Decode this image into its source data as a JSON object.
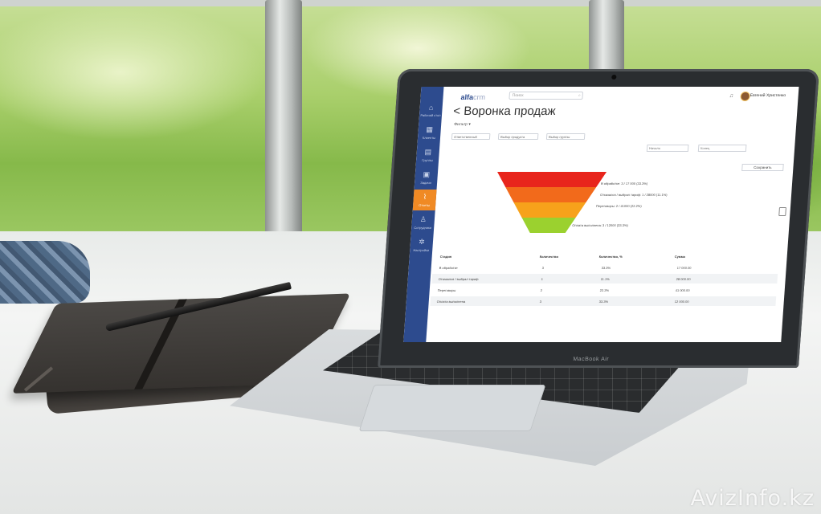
{
  "app": {
    "logo": "alfa",
    "logo_suffix": "crm",
    "search_placeholder": "Поиск",
    "user_name": "Евгений Христенко",
    "page_title": "< Воронка продаж",
    "filter_toggle": "Фильтр ▾",
    "dropdowns": [
      "Ответственный",
      "Выбор продукта",
      "Выбор группы"
    ],
    "date_from": "Начало",
    "date_to": "Конец",
    "save_button": "Сохранить",
    "sidebar": [
      {
        "icon": "home-icon",
        "label": "Рабочий стол",
        "glyph": "⌂"
      },
      {
        "icon": "grid-icon",
        "label": "Клиенты",
        "glyph": "▦"
      },
      {
        "icon": "calendar-icon",
        "label": "Группы",
        "glyph": "▤"
      },
      {
        "icon": "chart-icon",
        "label": "Задачи",
        "glyph": "▣"
      },
      {
        "icon": "funnel-icon",
        "label": "Отчеты",
        "glyph": "⌇"
      },
      {
        "icon": "user-icon",
        "label": "Сотрудники",
        "glyph": "♙"
      },
      {
        "icon": "gear-icon",
        "label": "Настройки",
        "glyph": "✲"
      }
    ],
    "funnel_colors": [
      "#e8251c",
      "#f26a1b",
      "#f7a21b",
      "#9bd12f"
    ],
    "funnel_labels": [
      "В обработке: 3 / 17 000 (33.3%)",
      "Отказался / выбрал тариф: 1 / 28000 (11.1%)",
      "Переговоры: 2 / 41000 (22.2%)",
      "Оплата выполнена: 3 / 12000 (33.3%)"
    ],
    "table": {
      "headers": [
        "Стадия",
        "Количество",
        "Количество, %",
        "Сумма"
      ],
      "rows": [
        [
          "В обработке",
          "3",
          "33.3%",
          "17 000.00"
        ],
        [
          "Отказался / выбрал тариф",
          "1",
          "11.1%",
          "28 000.00"
        ],
        [
          "Переговоры",
          "2",
          "22.2%",
          "41 000.00"
        ],
        [
          "Оплата выполнена",
          "3",
          "33.3%",
          "12 000.00"
        ]
      ]
    }
  },
  "laptop_brand": "MacBook Air",
  "watermark": "AvizInfo.kz"
}
